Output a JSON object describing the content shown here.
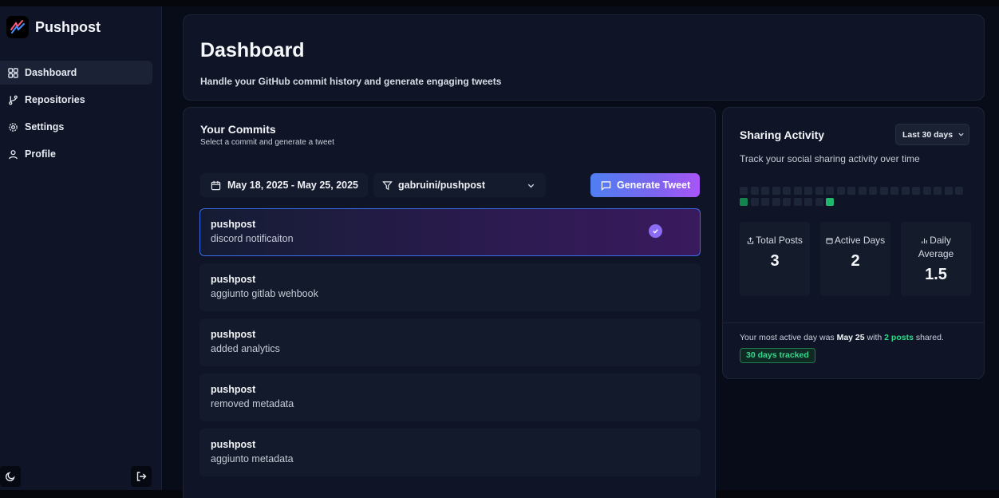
{
  "sidebar": {
    "brand": "Pushpost",
    "items": [
      {
        "label": "Dashboard",
        "icon": "grid-icon",
        "active": true
      },
      {
        "label": "Repositories",
        "icon": "git-branch-icon"
      },
      {
        "label": "Settings",
        "icon": "gear-icon"
      },
      {
        "label": "Profile",
        "icon": "user-icon"
      }
    ]
  },
  "header": {
    "title": "Dashboard",
    "subtitle": "Handle your GitHub commit history and generate engaging tweets"
  },
  "commits": {
    "title": "Your Commits",
    "subtitle": "Select a commit and generate a tweet",
    "date_range": "May 18, 2025 - May 25, 2025",
    "repo_filter": "gabruini/pushpost",
    "generate_label": "Generate Tweet",
    "items": [
      {
        "repo": "pushpost",
        "message": "discord notificaiton",
        "selected": true
      },
      {
        "repo": "pushpost",
        "message": "aggiunto gitlab wehbook"
      },
      {
        "repo": "pushpost",
        "message": "added analytics"
      },
      {
        "repo": "pushpost",
        "message": "removed metadata"
      },
      {
        "repo": "pushpost",
        "message": "aggiunto metadata"
      }
    ]
  },
  "activity": {
    "title": "Sharing Activity",
    "range": "Last 30 days",
    "description": "Track your social sharing activity over time",
    "heatmap_levels": [
      0,
      0,
      0,
      0,
      0,
      0,
      0,
      0,
      0,
      0,
      0,
      0,
      0,
      0,
      0,
      0,
      0,
      0,
      0,
      0,
      0,
      1,
      0,
      0,
      0,
      0,
      0,
      0,
      0,
      2
    ],
    "stats": [
      {
        "label": "Total Posts",
        "value": "3",
        "icon": "share-icon"
      },
      {
        "label": "Active Days",
        "value": "2",
        "icon": "calendar-icon"
      },
      {
        "label": "Daily Average",
        "value": "1.5",
        "icon": "bar-chart-icon"
      }
    ],
    "summary_prefix": "Your most active day was",
    "summary_day": "May 25",
    "summary_mid": "with",
    "summary_posts": "2 posts",
    "summary_suffix": "shared.",
    "tracked_badge": "30 days tracked"
  },
  "colors": {
    "accent_blue": "#4f7ff2",
    "accent_purple": "#a855f7",
    "success_green": "#2fd98a"
  }
}
